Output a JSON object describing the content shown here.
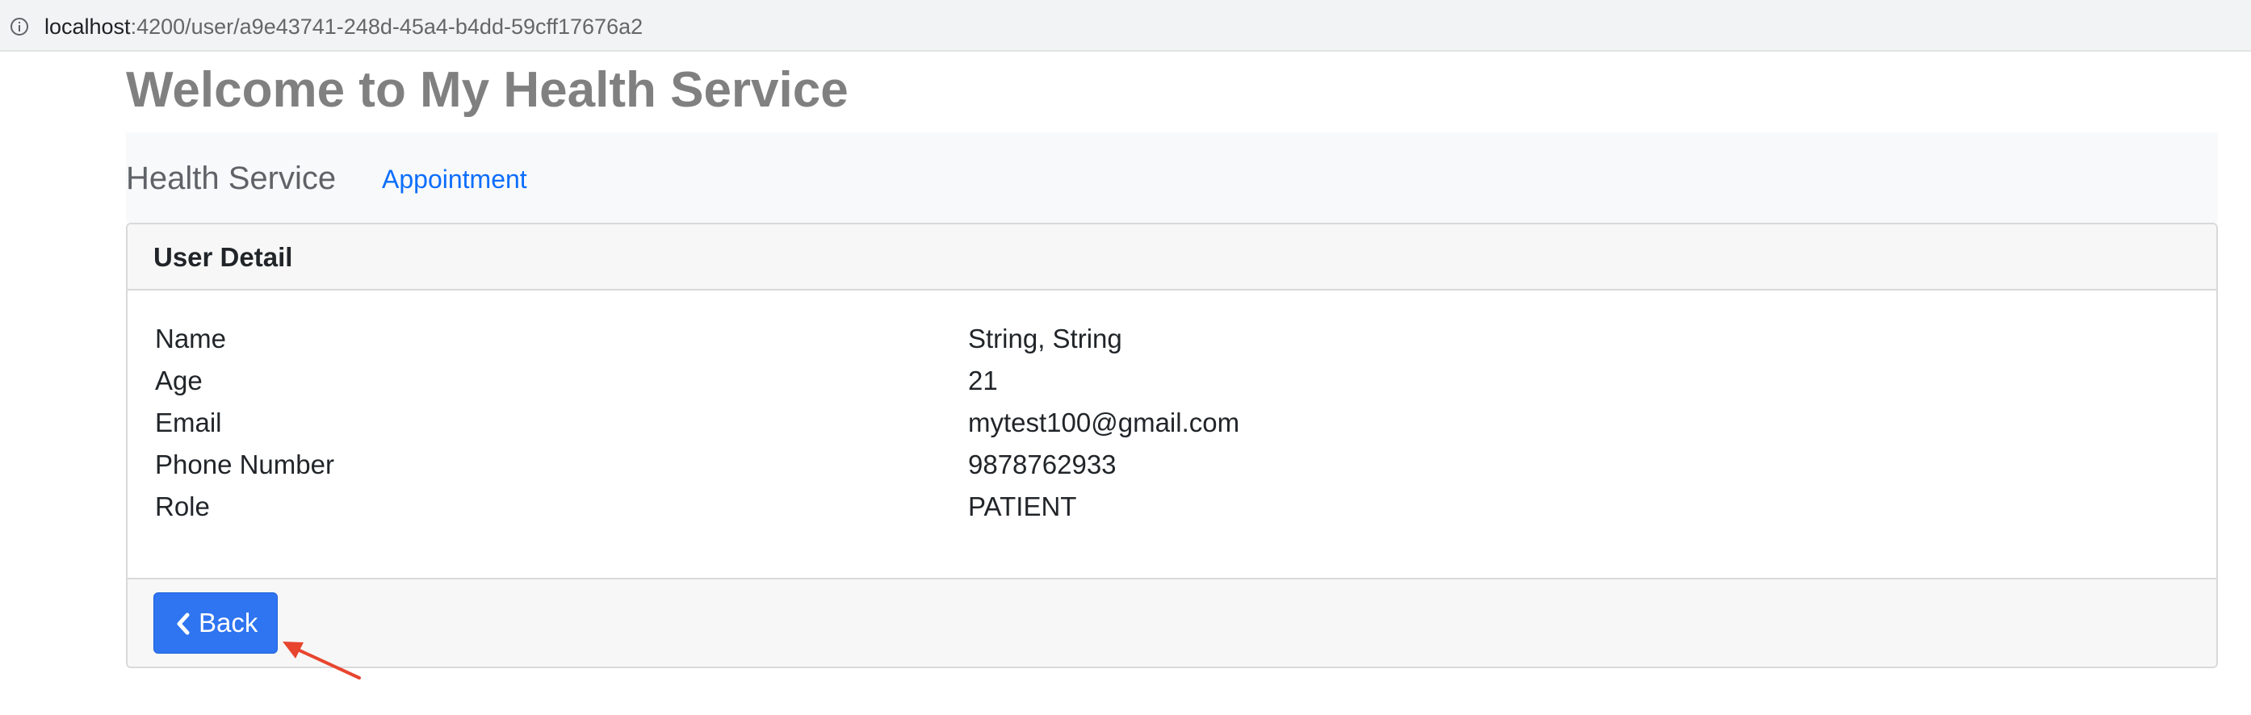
{
  "browser": {
    "url_host": "localhost",
    "url_rest": ":4200/user/a9e43741-248d-45a4-b4dd-59cff17676a2"
  },
  "page": {
    "title": "Welcome to My Health Service"
  },
  "navbar": {
    "brand": "Health Service",
    "links": [
      {
        "label": "Appointment"
      }
    ]
  },
  "card": {
    "header": "User Detail",
    "rows": [
      {
        "label": "Name",
        "value": "String, String"
      },
      {
        "label": "Age",
        "value": "21"
      },
      {
        "label": "Email",
        "value": "mytest100@gmail.com"
      },
      {
        "label": "Phone Number",
        "value": "9878762933"
      },
      {
        "label": "Role",
        "value": "PATIENT"
      }
    ],
    "footer": {
      "back_label": "Back"
    }
  },
  "colors": {
    "primary": "#2f74f0",
    "link": "#0d6efd",
    "title": "#808080",
    "annotation": "#e8452f"
  },
  "icons": {
    "info": "info-icon",
    "back": "chevron-left-icon",
    "annotation": "arrow-annotation-icon"
  }
}
